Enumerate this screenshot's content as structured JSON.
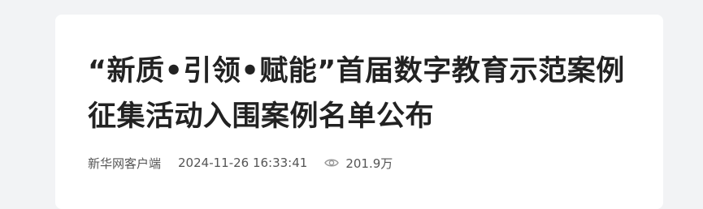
{
  "article": {
    "title": "“新质•引领•赋能”首届数字教育示范案例征集活动入围案例名单公布",
    "source": "新华网客户端",
    "published_at": "2024-11-26 16:33:41",
    "views": "201.9万"
  },
  "icons": {
    "views": "eye-icon"
  },
  "colors": {
    "page_bg": "#f2f3f5",
    "card_bg": "#ffffff",
    "title_text": "#222222",
    "meta_text": "#555555",
    "icon_stroke": "#999999"
  }
}
